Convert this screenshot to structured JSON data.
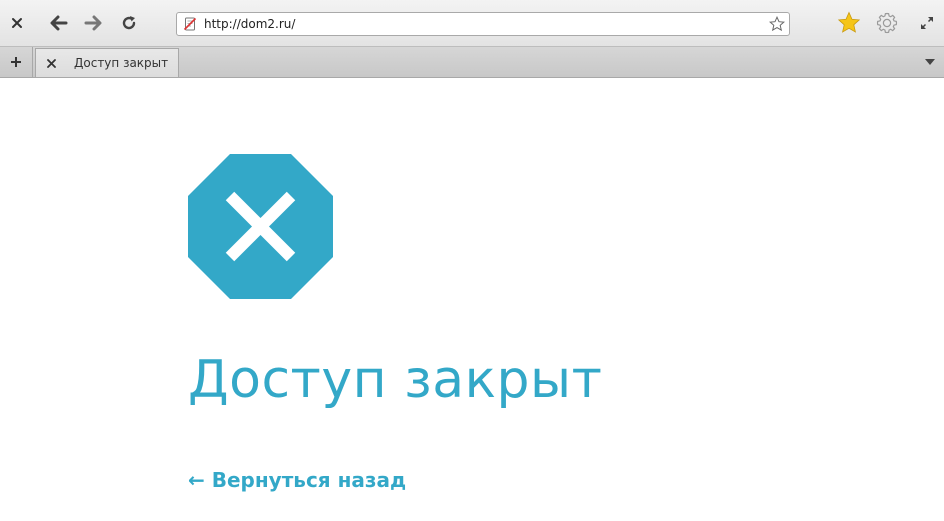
{
  "toolbar": {
    "close_icon": "close-icon",
    "back_icon": "arrow-left-icon",
    "forward_icon": "arrow-right-icon",
    "reload_icon": "reload-icon",
    "url": "http://dom2.ru/",
    "bookmark_star_icon": "star-outline-icon",
    "favorites_icon": "star-filled-icon",
    "settings_icon": "gear-icon",
    "fullscreen_icon": "expand-icon"
  },
  "tabs": {
    "new_tab_icon": "plus-icon",
    "items": [
      {
        "title": "Доступ закрыт",
        "close_icon": "close-icon"
      }
    ],
    "menu_icon": "triangle-down-icon"
  },
  "page": {
    "icon": "octagon-x-icon",
    "title": "Доступ закрыт",
    "back_link": "← Вернуться назад"
  },
  "colors": {
    "accent": "#33a8c8",
    "favorites_star": "#f5c518"
  }
}
